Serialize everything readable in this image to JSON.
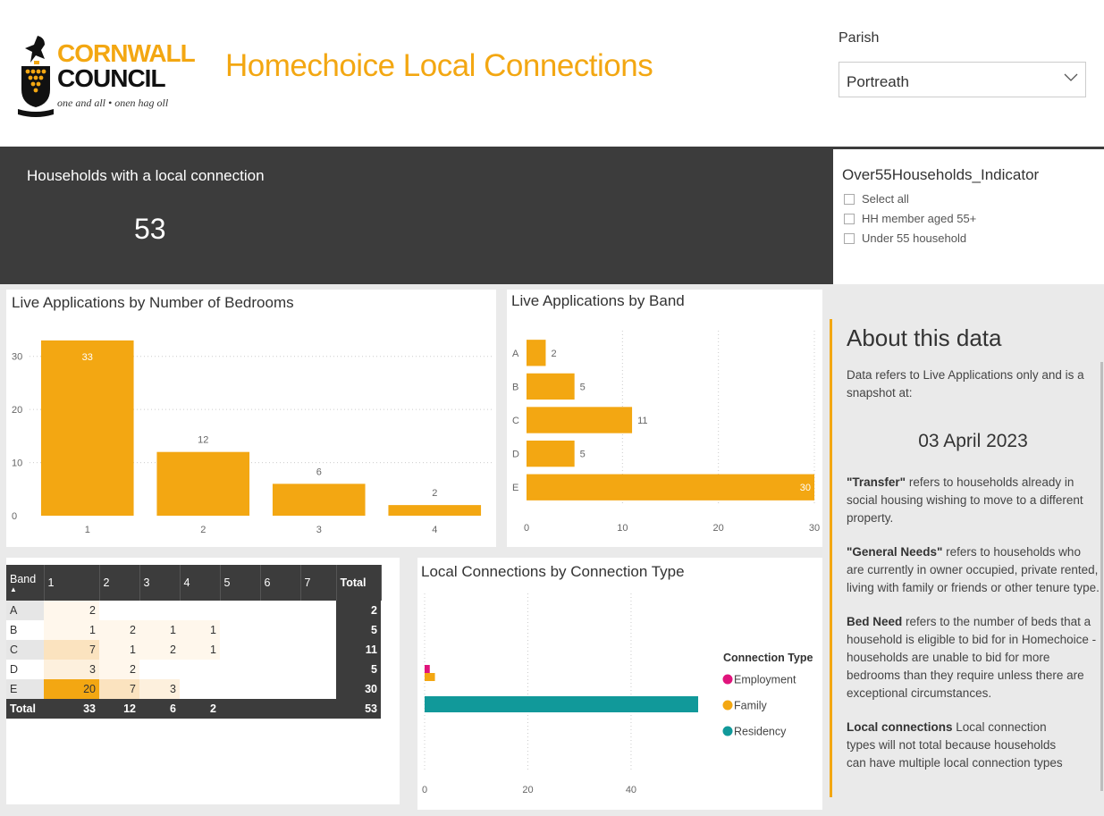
{
  "header": {
    "logo_line1": "CORNWALL",
    "logo_line2": "COUNCIL",
    "logo_tagline": "one and all • onen hag oll",
    "title": "Homechoice Local Connections",
    "parish_label": "Parish",
    "parish_value": "Portreath"
  },
  "kpi": {
    "label": "Households with a local connection",
    "value": "53"
  },
  "slicer": {
    "title": "Over55Households_Indicator",
    "options": [
      "Select all",
      "HH member aged 55+",
      "Under 55 household"
    ]
  },
  "about": {
    "title": "About this data",
    "intro": "Data refers to Live Applications only and is a snapshot at:",
    "date": "03 April 2023",
    "transfer_term": "\"Transfer\"",
    "transfer_text": " refers to households already in social housing wishing to move to a different property.",
    "general_term": "\"General Needs\"",
    "general_text": " refers to households who are currently in owner occupied, private rented, living with family or friends or other tenure type.",
    "bed_term": "Bed Need",
    "bed_text": " refers to the number of beds that a household is eligible to bid for in Homechoice - households are unable to bid for more bedrooms than they require unless there are exceptional circumstances.",
    "local_term": "Local connections",
    "local_text": " Local connection types will not total because households can have multiple local connection types"
  },
  "colors": {
    "accent": "#f3a712",
    "dark": "#3c3c3c",
    "employment": "#e0147c",
    "family": "#f3a712",
    "residency": "#11999a"
  },
  "matrix": {
    "headers": [
      "Band",
      "1",
      "2",
      "3",
      "4",
      "5",
      "6",
      "7",
      "Total"
    ],
    "rows": [
      {
        "band": "A",
        "cells": [
          "2",
          "",
          "",
          "",
          "",
          "",
          ""
        ],
        "total": "2"
      },
      {
        "band": "B",
        "cells": [
          "1",
          "2",
          "1",
          "1",
          "",
          "",
          ""
        ],
        "total": "5"
      },
      {
        "band": "C",
        "cells": [
          "7",
          "1",
          "2",
          "1",
          "",
          "",
          ""
        ],
        "total": "11"
      },
      {
        "band": "D",
        "cells": [
          "3",
          "2",
          "",
          "",
          "",
          "",
          ""
        ],
        "total": "5"
      },
      {
        "band": "E",
        "cells": [
          "20",
          "7",
          "3",
          "",
          "",
          "",
          ""
        ],
        "total": "30"
      }
    ],
    "total_row": {
      "label": "Total",
      "cells": [
        "33",
        "12",
        "6",
        "2",
        "",
        "",
        ""
      ],
      "total": "53"
    }
  },
  "chart_data": [
    {
      "type": "bar",
      "title": "Live Applications by Number of Bedrooms",
      "categories": [
        "1",
        "2",
        "3",
        "4"
      ],
      "values": [
        33,
        12,
        6,
        2
      ],
      "data_labels": [
        "33",
        "12",
        "6",
        "2"
      ],
      "yticks": [
        "0",
        "10",
        "20",
        "30"
      ],
      "ylim": [
        0,
        35
      ],
      "color": "#f3a712",
      "grid": true
    },
    {
      "type": "bar",
      "orientation": "horizontal",
      "title": "Live Applications by Band",
      "categories": [
        "A",
        "B",
        "C",
        "D",
        "E"
      ],
      "values": [
        2,
        5,
        11,
        5,
        30
      ],
      "data_labels": [
        "2",
        "5",
        "11",
        "5",
        "30"
      ],
      "xticks": [
        "0",
        "10",
        "20",
        "30"
      ],
      "xlim": [
        0,
        30
      ],
      "color": "#f3a712",
      "grid": true
    },
    {
      "type": "bar",
      "orientation": "horizontal",
      "title": "Local Connections by Connection Type",
      "legend_title": "Connection Type",
      "legend_position": "right",
      "series": [
        {
          "name": "Employment",
          "value": 1,
          "color": "#e0147c"
        },
        {
          "name": "Family",
          "value": 2,
          "color": "#f3a712"
        },
        {
          "name": "Residency",
          "value": 53,
          "color": "#11999a"
        }
      ],
      "xticks": [
        "0",
        "20",
        "40"
      ],
      "xlim": [
        0,
        53
      ],
      "grid": true
    }
  ]
}
